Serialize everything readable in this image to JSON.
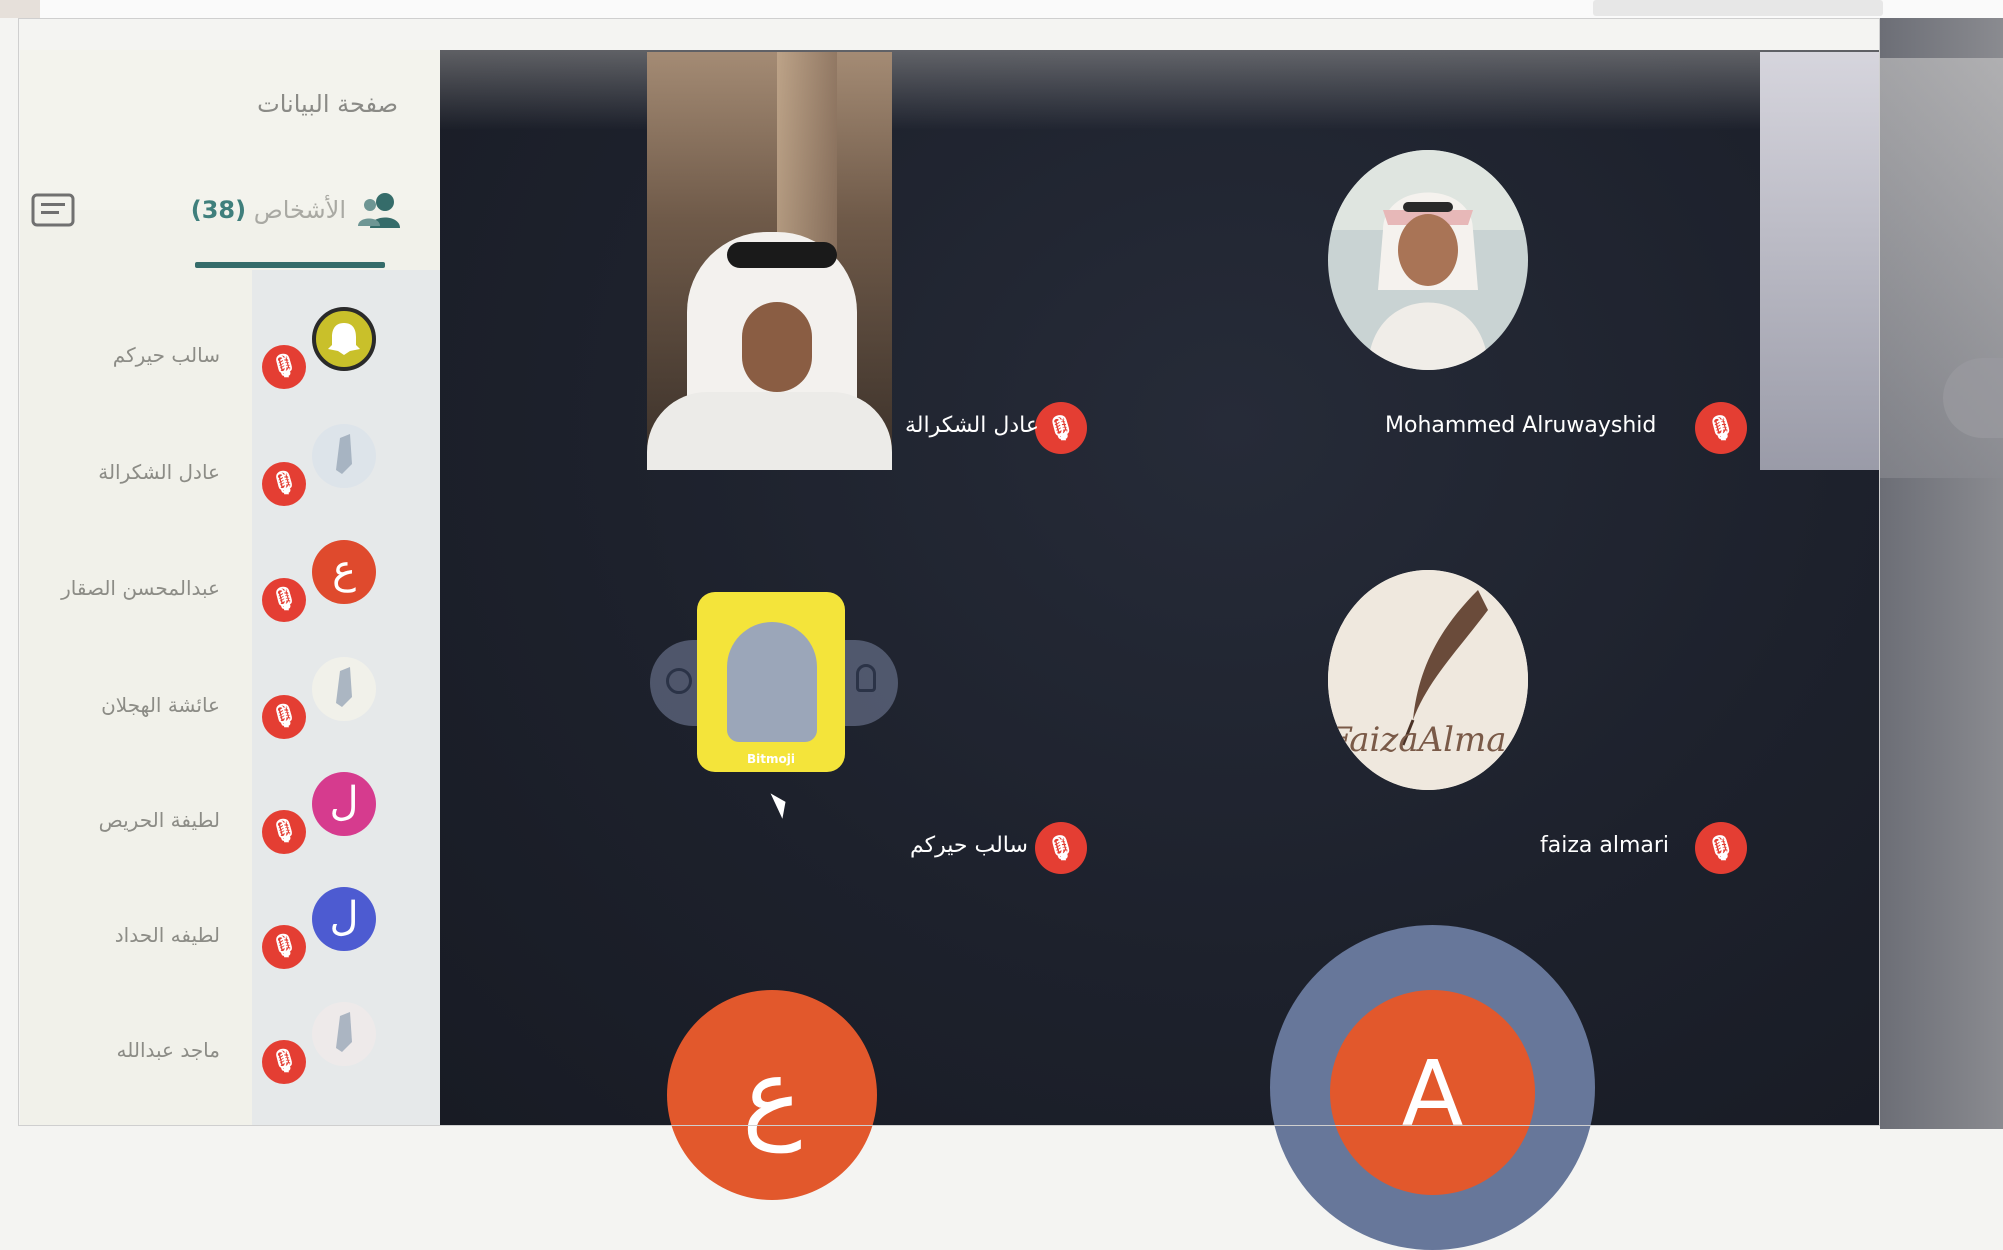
{
  "sidebar": {
    "title": "صفحة البيانات",
    "people_tab": {
      "label": "الأشخاص",
      "count": "(38)"
    },
    "participants": [
      {
        "name": "سالب حيركم",
        "avatar_letter": "",
        "avatar_color": "#c9c02a",
        "avatar_icon": "snapchat-ghost-icon"
      },
      {
        "name": "عادل الشكرالة",
        "avatar_letter": "",
        "avatar_color": "#dde4ea",
        "avatar_icon": "photo-icon"
      },
      {
        "name": "عبدالمحسن الصقار",
        "avatar_letter": "ع",
        "avatar_color": "#df4a2d",
        "avatar_icon": ""
      },
      {
        "name": "عائشة الهجلان",
        "avatar_letter": "",
        "avatar_color": "#f1f1ea",
        "avatar_icon": "photo-icon"
      },
      {
        "name": "لطيفة الحريص",
        "avatar_letter": "ل",
        "avatar_color": "#d63b8e",
        "avatar_icon": ""
      },
      {
        "name": "لطيفه الحداد",
        "avatar_letter": "ل",
        "avatar_color": "#4d5bd1",
        "avatar_icon": ""
      },
      {
        "name": "ماجد عبدالله",
        "avatar_letter": "",
        "avatar_color": "#eeeaea",
        "avatar_icon": "photo-icon"
      }
    ]
  },
  "stage": {
    "tiles": [
      {
        "name": "عادل الشكرالة",
        "kind": "video"
      },
      {
        "name": "Mohammed Alruwayshid",
        "kind": "photo"
      },
      {
        "name": "سالب حيركم",
        "kind": "snapchat"
      },
      {
        "name": "faiza almari",
        "kind": "photo",
        "avatar_text": "FaizaAlma"
      }
    ],
    "snap_caption": "Bitmoji",
    "bottom_avatars": [
      {
        "letter": "ع",
        "color": "#e2582c"
      },
      {
        "letter": "A",
        "color": "#e2582c",
        "ring_color": "#6b7b9e"
      }
    ]
  },
  "colors": {
    "mic_red": "#e43e33",
    "accent_teal": "#356c6a",
    "stage_bg": "#1f2330"
  }
}
